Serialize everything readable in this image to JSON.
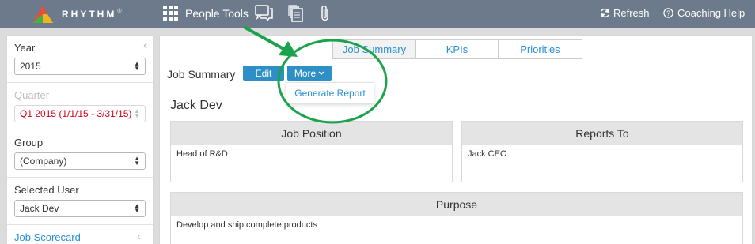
{
  "app": {
    "logo_text": "RHYTHM",
    "logo_reg": "®"
  },
  "topbar": {
    "people_tools": "People Tools",
    "refresh": "Refresh",
    "coaching_help": "Coaching Help",
    "icons": [
      "grid-icon",
      "chat-icon",
      "documents-icon",
      "attachment-icon",
      "refresh-icon",
      "help-icon"
    ]
  },
  "sidebar": {
    "year": {
      "label": "Year",
      "value": "2015"
    },
    "quarter": {
      "label": "Quarter",
      "value": "Q1 2015 (1/1/15 - 3/31/15)"
    },
    "group": {
      "label": "Group",
      "value": "(Company)"
    },
    "selected_user": {
      "label": "Selected User",
      "value": "Jack Dev"
    },
    "job_scorecard": "Job Scorecard"
  },
  "main": {
    "tabs": [
      {
        "label": "Job Summary",
        "active": true
      },
      {
        "label": "KPIs",
        "active": false
      },
      {
        "label": "Priorities",
        "active": false
      }
    ],
    "section_title": "Job Summary",
    "edit_label": "Edit",
    "more_label": "More",
    "dropdown_item": "Generate Report",
    "user_name": "Jack Dev",
    "job_position": {
      "title": "Job Position",
      "value": "Head of R&D"
    },
    "reports_to": {
      "title": "Reports To",
      "value": "Jack CEO"
    },
    "purpose": {
      "title": "Purpose",
      "value": "Develop and ship complete products"
    }
  },
  "colors": {
    "topbar": "#6d7a8b",
    "accent_blue": "#2d8fc6",
    "link_blue": "#2a8fd6",
    "annotation_green": "#1aa34a",
    "error_red": "#d0021b"
  }
}
